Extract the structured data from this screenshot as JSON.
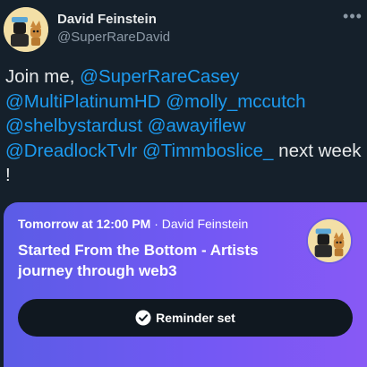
{
  "author": {
    "display_name": "David Feinstein",
    "handle": "@SuperRareDavid"
  },
  "more_icon": "more-horizontal-icon",
  "tweet": {
    "intro": "Join me, ",
    "mentions": [
      "@SuperRareCasey",
      "@MultiPlatinumHD",
      "@molly_mccutch",
      "@shelbystardust",
      "@awayiflew",
      "@DreadlockTvlr",
      "@Timmboslice_"
    ],
    "outro": " next week !"
  },
  "space_card": {
    "when": "Tomorrow at 12:00 PM",
    "separator": " · ",
    "host": "David Feinstein",
    "title": "Started From the Bottom - Artists journey through web3",
    "reminder_label": "Reminder set",
    "reminder_icon": "check-circle-icon"
  },
  "colors": {
    "background": "#15202b",
    "mention": "#1d9bf0",
    "card_gradient_start": "#5b5ce6",
    "card_gradient_end": "#8859f5",
    "button_bg": "#101820"
  }
}
